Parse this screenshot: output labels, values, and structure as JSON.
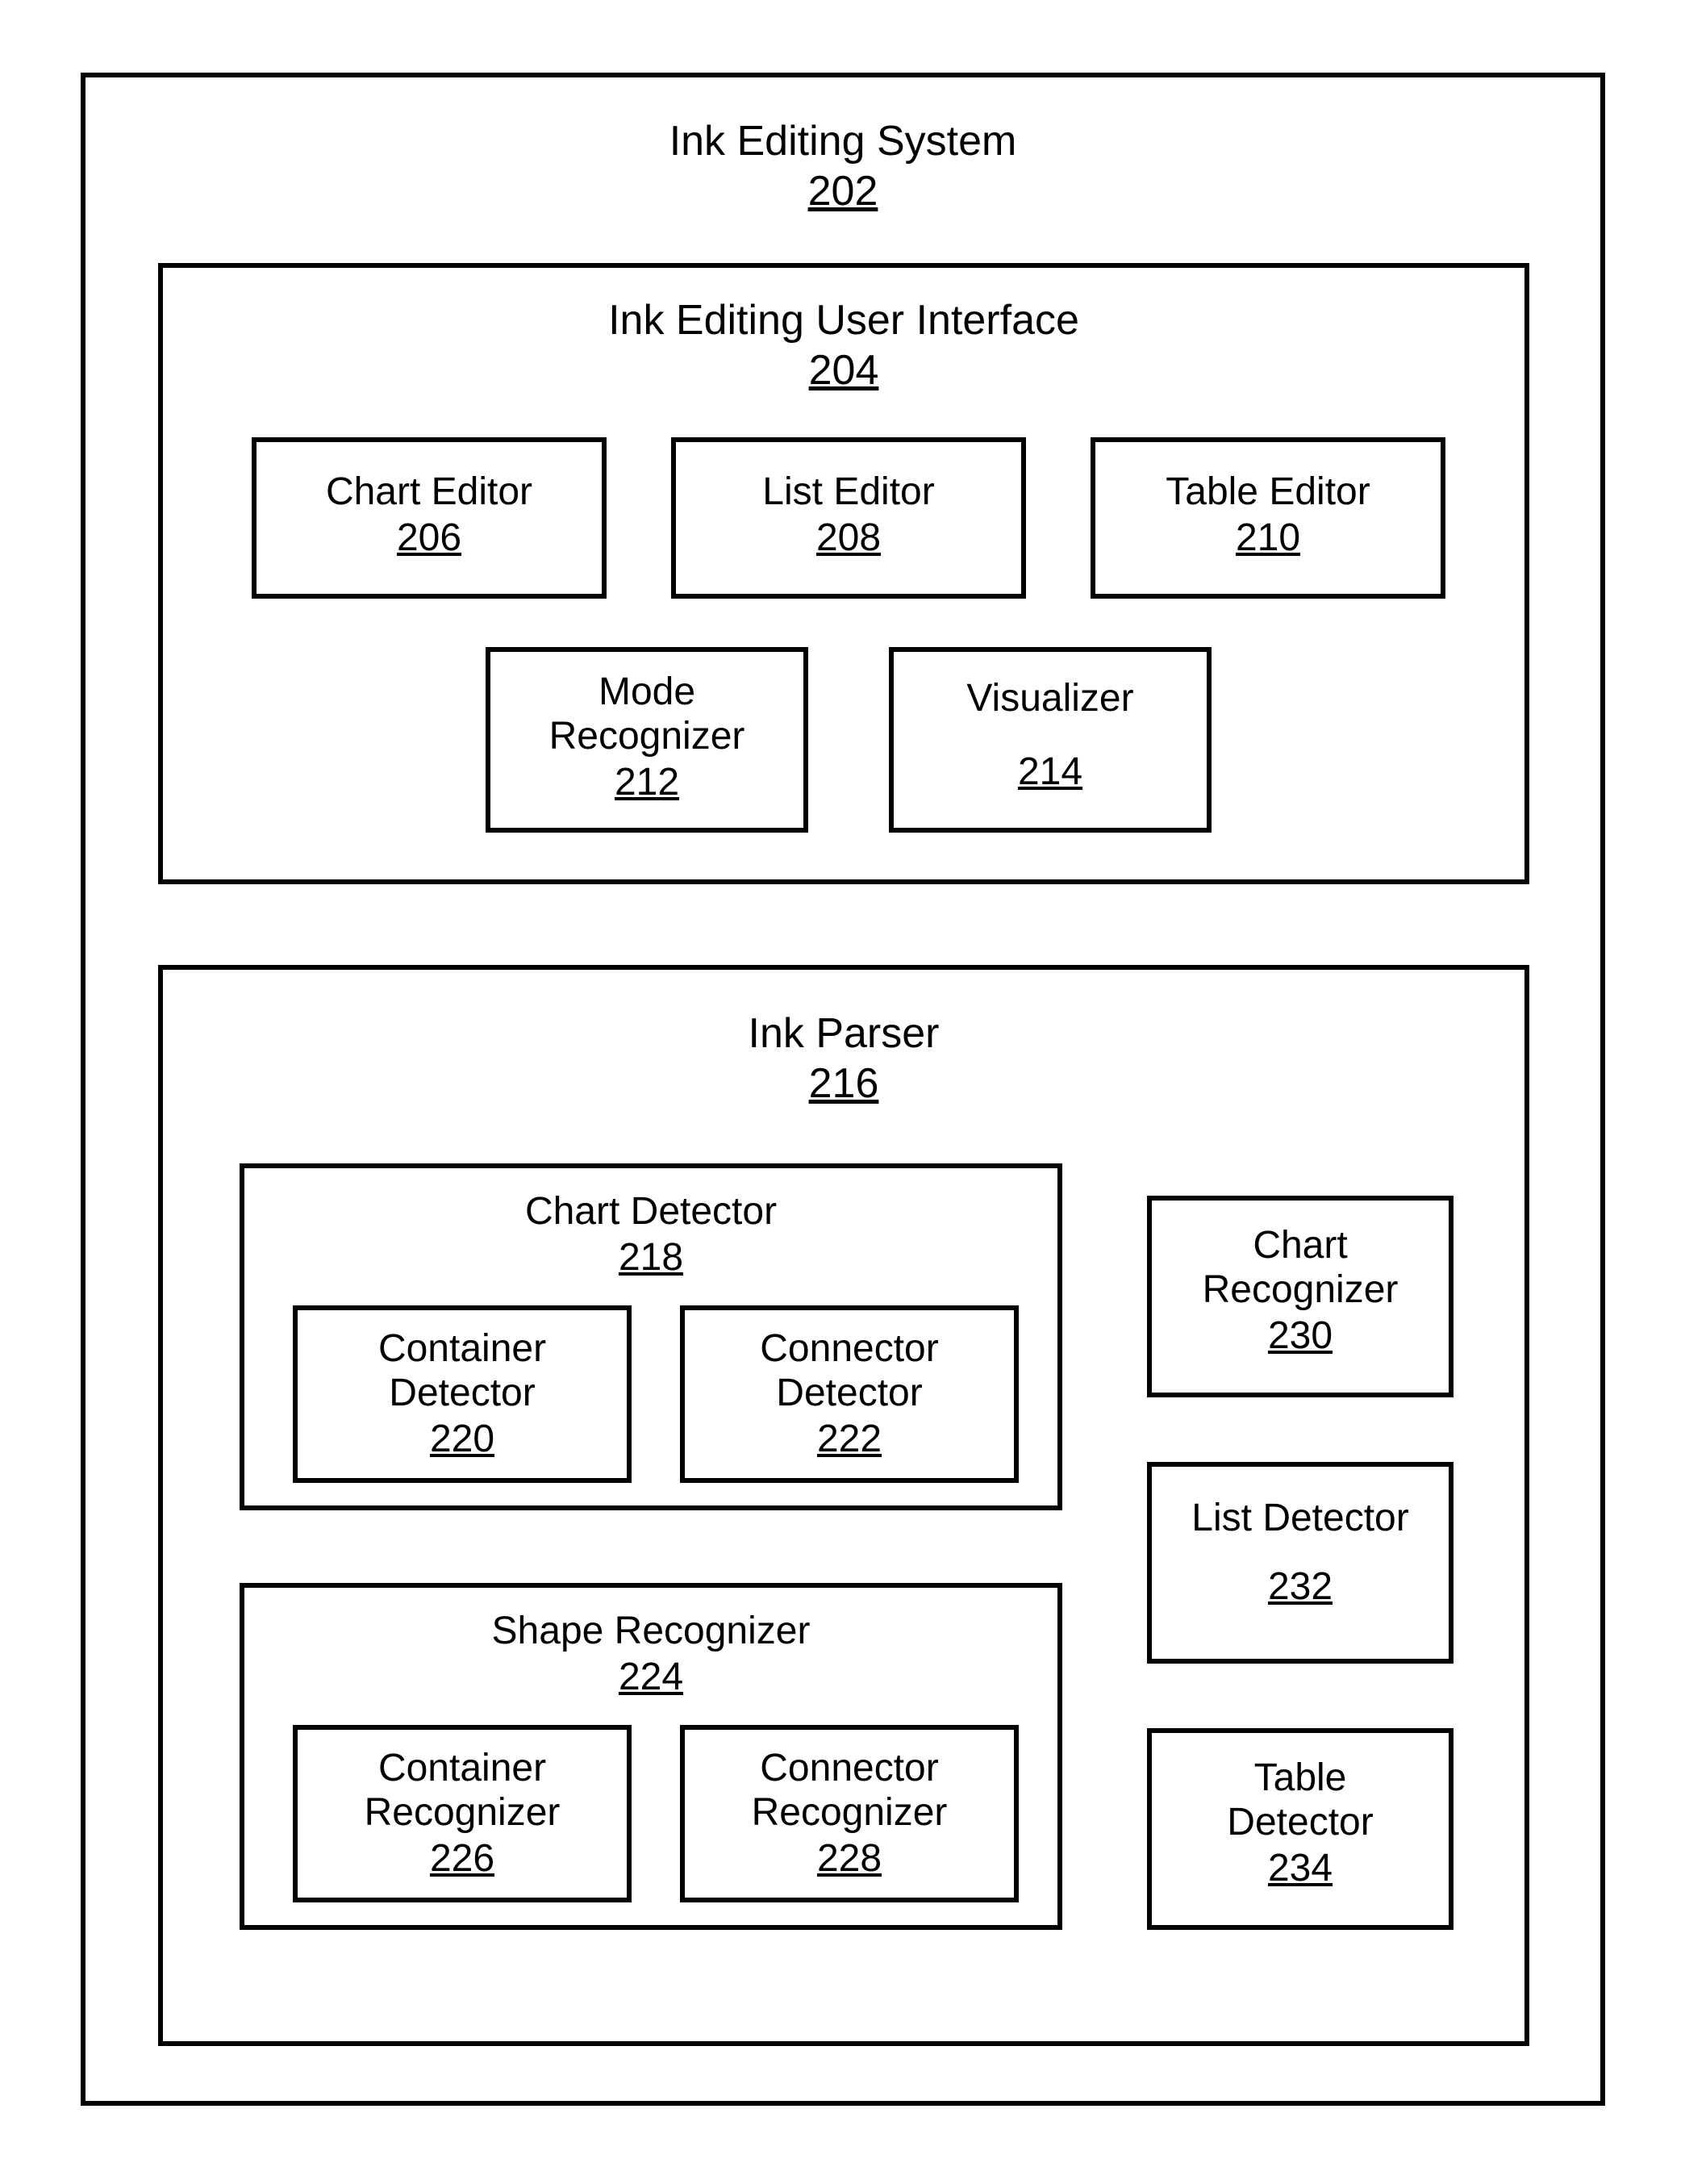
{
  "system": {
    "title": "Ink Editing System",
    "ref": "202"
  },
  "ui": {
    "title": "Ink Editing User Interface",
    "ref": "204",
    "chart_editor": {
      "title": "Chart Editor",
      "ref": "206"
    },
    "list_editor": {
      "title": "List Editor",
      "ref": "208"
    },
    "table_editor": {
      "title": "Table Editor",
      "ref": "210"
    },
    "mode_recognizer": {
      "title": "Mode\nRecognizer",
      "ref": "212"
    },
    "visualizer": {
      "title": "Visualizer",
      "ref": "214"
    }
  },
  "parser": {
    "title": "Ink Parser",
    "ref": "216",
    "chart_detector": {
      "title": "Chart Detector",
      "ref": "218",
      "container_detector": {
        "title": "Container\nDetector",
        "ref": "220"
      },
      "connector_detector": {
        "title": "Connector\nDetector",
        "ref": "222"
      }
    },
    "shape_recognizer": {
      "title": "Shape Recognizer",
      "ref": "224",
      "container_recognizer": {
        "title": "Container\nRecognizer",
        "ref": "226"
      },
      "connector_recognizer": {
        "title": "Connector\nRecognizer",
        "ref": "228"
      }
    },
    "chart_recognizer": {
      "title": "Chart\nRecognizer",
      "ref": "230"
    },
    "list_detector": {
      "title": "List Detector",
      "ref": "232"
    },
    "table_detector": {
      "title": "Table\nDetector",
      "ref": "234"
    }
  }
}
